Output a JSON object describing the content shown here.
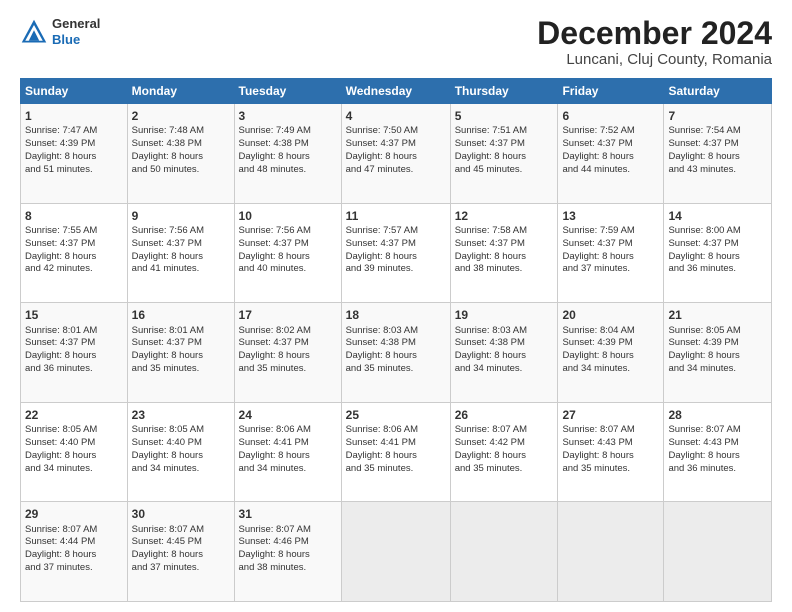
{
  "header": {
    "logo_line1": "General",
    "logo_line2": "Blue",
    "title": "December 2024",
    "subtitle": "Luncani, Cluj County, Romania"
  },
  "days_of_week": [
    "Sunday",
    "Monday",
    "Tuesday",
    "Wednesday",
    "Thursday",
    "Friday",
    "Saturday"
  ],
  "weeks": [
    [
      {
        "day": "1",
        "lines": [
          "Sunrise: 7:47 AM",
          "Sunset: 4:39 PM",
          "Daylight: 8 hours",
          "and 51 minutes."
        ]
      },
      {
        "day": "2",
        "lines": [
          "Sunrise: 7:48 AM",
          "Sunset: 4:38 PM",
          "Daylight: 8 hours",
          "and 50 minutes."
        ]
      },
      {
        "day": "3",
        "lines": [
          "Sunrise: 7:49 AM",
          "Sunset: 4:38 PM",
          "Daylight: 8 hours",
          "and 48 minutes."
        ]
      },
      {
        "day": "4",
        "lines": [
          "Sunrise: 7:50 AM",
          "Sunset: 4:37 PM",
          "Daylight: 8 hours",
          "and 47 minutes."
        ]
      },
      {
        "day": "5",
        "lines": [
          "Sunrise: 7:51 AM",
          "Sunset: 4:37 PM",
          "Daylight: 8 hours",
          "and 45 minutes."
        ]
      },
      {
        "day": "6",
        "lines": [
          "Sunrise: 7:52 AM",
          "Sunset: 4:37 PM",
          "Daylight: 8 hours",
          "and 44 minutes."
        ]
      },
      {
        "day": "7",
        "lines": [
          "Sunrise: 7:54 AM",
          "Sunset: 4:37 PM",
          "Daylight: 8 hours",
          "and 43 minutes."
        ]
      }
    ],
    [
      {
        "day": "8",
        "lines": [
          "Sunrise: 7:55 AM",
          "Sunset: 4:37 PM",
          "Daylight: 8 hours",
          "and 42 minutes."
        ]
      },
      {
        "day": "9",
        "lines": [
          "Sunrise: 7:56 AM",
          "Sunset: 4:37 PM",
          "Daylight: 8 hours",
          "and 41 minutes."
        ]
      },
      {
        "day": "10",
        "lines": [
          "Sunrise: 7:56 AM",
          "Sunset: 4:37 PM",
          "Daylight: 8 hours",
          "and 40 minutes."
        ]
      },
      {
        "day": "11",
        "lines": [
          "Sunrise: 7:57 AM",
          "Sunset: 4:37 PM",
          "Daylight: 8 hours",
          "and 39 minutes."
        ]
      },
      {
        "day": "12",
        "lines": [
          "Sunrise: 7:58 AM",
          "Sunset: 4:37 PM",
          "Daylight: 8 hours",
          "and 38 minutes."
        ]
      },
      {
        "day": "13",
        "lines": [
          "Sunrise: 7:59 AM",
          "Sunset: 4:37 PM",
          "Daylight: 8 hours",
          "and 37 minutes."
        ]
      },
      {
        "day": "14",
        "lines": [
          "Sunrise: 8:00 AM",
          "Sunset: 4:37 PM",
          "Daylight: 8 hours",
          "and 36 minutes."
        ]
      }
    ],
    [
      {
        "day": "15",
        "lines": [
          "Sunrise: 8:01 AM",
          "Sunset: 4:37 PM",
          "Daylight: 8 hours",
          "and 36 minutes."
        ]
      },
      {
        "day": "16",
        "lines": [
          "Sunrise: 8:01 AM",
          "Sunset: 4:37 PM",
          "Daylight: 8 hours",
          "and 35 minutes."
        ]
      },
      {
        "day": "17",
        "lines": [
          "Sunrise: 8:02 AM",
          "Sunset: 4:37 PM",
          "Daylight: 8 hours",
          "and 35 minutes."
        ]
      },
      {
        "day": "18",
        "lines": [
          "Sunrise: 8:03 AM",
          "Sunset: 4:38 PM",
          "Daylight: 8 hours",
          "and 35 minutes."
        ]
      },
      {
        "day": "19",
        "lines": [
          "Sunrise: 8:03 AM",
          "Sunset: 4:38 PM",
          "Daylight: 8 hours",
          "and 34 minutes."
        ]
      },
      {
        "day": "20",
        "lines": [
          "Sunrise: 8:04 AM",
          "Sunset: 4:39 PM",
          "Daylight: 8 hours",
          "and 34 minutes."
        ]
      },
      {
        "day": "21",
        "lines": [
          "Sunrise: 8:05 AM",
          "Sunset: 4:39 PM",
          "Daylight: 8 hours",
          "and 34 minutes."
        ]
      }
    ],
    [
      {
        "day": "22",
        "lines": [
          "Sunrise: 8:05 AM",
          "Sunset: 4:40 PM",
          "Daylight: 8 hours",
          "and 34 minutes."
        ]
      },
      {
        "day": "23",
        "lines": [
          "Sunrise: 8:05 AM",
          "Sunset: 4:40 PM",
          "Daylight: 8 hours",
          "and 34 minutes."
        ]
      },
      {
        "day": "24",
        "lines": [
          "Sunrise: 8:06 AM",
          "Sunset: 4:41 PM",
          "Daylight: 8 hours",
          "and 34 minutes."
        ]
      },
      {
        "day": "25",
        "lines": [
          "Sunrise: 8:06 AM",
          "Sunset: 4:41 PM",
          "Daylight: 8 hours",
          "and 35 minutes."
        ]
      },
      {
        "day": "26",
        "lines": [
          "Sunrise: 8:07 AM",
          "Sunset: 4:42 PM",
          "Daylight: 8 hours",
          "and 35 minutes."
        ]
      },
      {
        "day": "27",
        "lines": [
          "Sunrise: 8:07 AM",
          "Sunset: 4:43 PM",
          "Daylight: 8 hours",
          "and 35 minutes."
        ]
      },
      {
        "day": "28",
        "lines": [
          "Sunrise: 8:07 AM",
          "Sunset: 4:43 PM",
          "Daylight: 8 hours",
          "and 36 minutes."
        ]
      }
    ],
    [
      {
        "day": "29",
        "lines": [
          "Sunrise: 8:07 AM",
          "Sunset: 4:44 PM",
          "Daylight: 8 hours",
          "and 37 minutes."
        ]
      },
      {
        "day": "30",
        "lines": [
          "Sunrise: 8:07 AM",
          "Sunset: 4:45 PM",
          "Daylight: 8 hours",
          "and 37 minutes."
        ]
      },
      {
        "day": "31",
        "lines": [
          "Sunrise: 8:07 AM",
          "Sunset: 4:46 PM",
          "Daylight: 8 hours",
          "and 38 minutes."
        ]
      },
      null,
      null,
      null,
      null
    ]
  ]
}
